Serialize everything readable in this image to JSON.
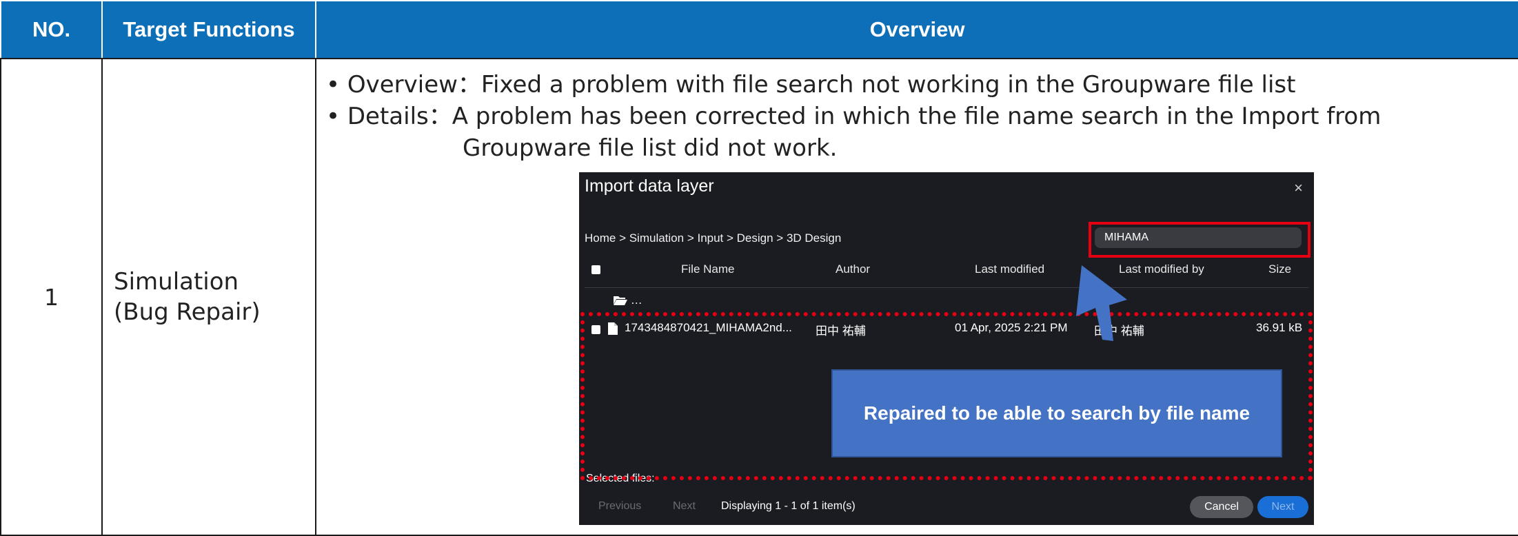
{
  "table": {
    "headers": {
      "no": "NO.",
      "functions": "Target Functions",
      "overview": "Overview"
    },
    "row": {
      "no": "1",
      "function_line1": "Simulation",
      "function_line2": "(Bug Repair)",
      "overview_line": "• Overview：Fixed a problem with file search not working in the Groupware file list",
      "details_line1": "• Details：A problem has been corrected in which the file name search in the Import from",
      "details_line2": "Groupware file list did not work."
    }
  },
  "dialog": {
    "title": "Import data layer",
    "close": "×",
    "breadcrumb": "Home > Simulation > Input > Design > 3D Design",
    "search_value": "MIHAMA",
    "columns": {
      "file_name": "File Name",
      "author": "Author",
      "last_modified": "Last modified",
      "last_modified_by": "Last modified by",
      "size": "Size"
    },
    "parent_folder": "…",
    "file": {
      "name": "1743484870421_MIHAMA2nd...",
      "author": "田中 祐輔",
      "modified": "01 Apr, 2025 2:21 PM",
      "modified_by": "田中 祐輔",
      "size": "36.91 kB"
    },
    "selected_files": "Selected files:",
    "previous": "Previous",
    "next_link": "Next",
    "displaying": "Displaying 1 - 1 of 1 item(s)",
    "cancel": "Cancel",
    "next_button": "Next"
  },
  "callout": "Repaired to be able to search by file name",
  "icons": [
    "folder-icon",
    "file-icon",
    "close-icon",
    "arrow-icon"
  ],
  "colors": {
    "header_bg": "#0d6fb8",
    "highlight": "#e60012",
    "callout_bg": "#4472c4",
    "dialog_bg": "#1b1c21"
  }
}
